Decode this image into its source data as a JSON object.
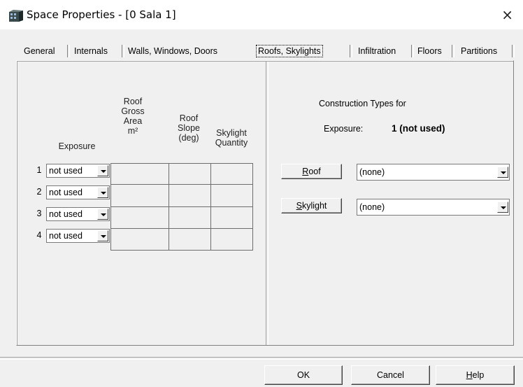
{
  "window": {
    "title": "Space Properties - [0 Sala 1]",
    "close_glyph": "×",
    "icon": "building-icon"
  },
  "tabs": [
    {
      "label": "General",
      "active": false
    },
    {
      "label": "Internals",
      "active": false
    },
    {
      "label": "Walls, Windows, Doors",
      "active": false
    },
    {
      "label": "Roofs, Skylights",
      "active": true
    },
    {
      "label": "Infiltration",
      "active": false
    },
    {
      "label": "Floors",
      "active": false
    },
    {
      "label": "Partitions",
      "active": false
    }
  ],
  "table": {
    "headers": {
      "exposure": "Exposure",
      "area_l1": "Roof",
      "area_l2": "Gross",
      "area_l3": "Area",
      "area_unit": "m²",
      "slope_l1": "Roof",
      "slope_l2": "Slope",
      "slope_l3": "(deg)",
      "qty_l1": "Skylight",
      "qty_l2": "Quantity"
    },
    "rows": [
      {
        "num": "1",
        "exposure": "not used",
        "area": "",
        "slope": "",
        "qty": ""
      },
      {
        "num": "2",
        "exposure": "not used",
        "area": "",
        "slope": "",
        "qty": ""
      },
      {
        "num": "3",
        "exposure": "not used",
        "area": "",
        "slope": "",
        "qty": ""
      },
      {
        "num": "4",
        "exposure": "not used",
        "area": "",
        "slope": "",
        "qty": ""
      }
    ]
  },
  "construction": {
    "title": "Construction Types for",
    "exposure_label": "Exposure:",
    "exposure_value": "1 (not used)",
    "roof_button_key": "R",
    "roof_button_rest": "oof",
    "roof_value": "(none)",
    "skylight_button_key": "S",
    "skylight_button_rest": "kylight",
    "skylight_value": "(none)"
  },
  "footer": {
    "ok": "OK",
    "cancel": "Cancel",
    "help_key": "H",
    "help_rest": "elp"
  }
}
